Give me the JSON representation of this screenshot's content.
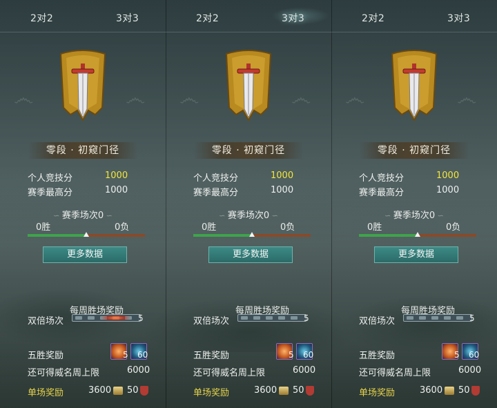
{
  "tabs": {
    "two": "2对2",
    "three": "3对3"
  },
  "panels": [
    {
      "rank": "零段 · 初窥门径",
      "personal_label": "个人竞技分",
      "personal_value": "1000",
      "season_best_label": "赛季最高分",
      "season_best_value": "1000",
      "season_matches": "赛季场次0",
      "wins": "0胜",
      "losses": "0负",
      "win_ratio": 0.5,
      "more_button": "更多数据",
      "weekly_title": "每周胜场奖励",
      "double_label": "双倍场次",
      "double_max": "5",
      "five_win_label": "五胜奖励",
      "item1_count": "5",
      "item2_count": "60",
      "weekly_cap_label": "还可得威名周上限",
      "weekly_cap_value": "6000",
      "single_label": "单场奖励",
      "single_coin": "3600",
      "single_shield": "50",
      "active_tab": "two"
    },
    {
      "rank": "零段 · 初窥门径",
      "personal_label": "个人竞技分",
      "personal_value": "1000",
      "season_best_label": "赛季最高分",
      "season_best_value": "1000",
      "season_matches": "赛季场次0",
      "wins": "0胜",
      "losses": "0负",
      "win_ratio": 0.5,
      "more_button": "更多数据",
      "weekly_title": "每周胜场奖励",
      "double_label": "双倍场次",
      "double_max": "5",
      "five_win_label": "五胜奖励",
      "item1_count": "5",
      "item2_count": "60",
      "weekly_cap_label": "还可得威名周上限",
      "weekly_cap_value": "6000",
      "single_label": "单场奖励",
      "single_coin": "3600",
      "single_shield": "50",
      "active_tab": "three"
    },
    {
      "rank": "零段 · 初窥门径",
      "personal_label": "个人竞技分",
      "personal_value": "1000",
      "season_best_label": "赛季最高分",
      "season_best_value": "1000",
      "season_matches": "赛季场次0",
      "wins": "0胜",
      "losses": "0负",
      "win_ratio": 0.5,
      "more_button": "更多数据",
      "weekly_title": "每周胜场奖励",
      "double_label": "双倍场次",
      "double_max": "5",
      "five_win_label": "五胜奖励",
      "item1_count": "5",
      "item2_count": "60",
      "weekly_cap_label": "还可得威名周上限",
      "weekly_cap_value": "6000",
      "single_label": "单场奖励",
      "single_coin": "3600",
      "single_shield": "50",
      "active_tab": "three"
    }
  ],
  "colors": {
    "accent_yellow": "#f3e73a",
    "win_green": "#3fa34c",
    "loss_brown": "#8a4a2a",
    "button_teal": "#2b6b68"
  },
  "icons": [
    "sword-banner-emblem-icon",
    "coin-icon",
    "shield-icon",
    "fire-scroll-item-icon",
    "blue-feather-item-icon"
  ]
}
